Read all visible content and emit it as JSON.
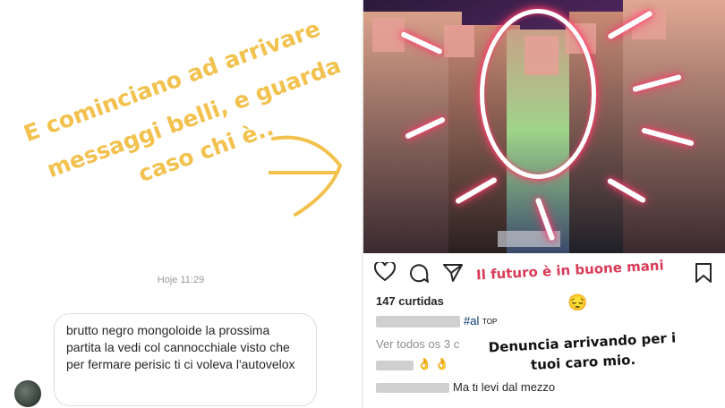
{
  "story": {
    "handwritten_lines": [
      "E cominciano ad arrivare",
      "messaggi belli, e guarda",
      "caso chi è.."
    ],
    "accent_color": "#f2c14e"
  },
  "dm": {
    "timestamp": "Hoje 11:29",
    "message": "brutto negro mongoloide la prossima partita la vedi col cannocchiale visto che per fermare perisic ti ci voleva l'autovelox"
  },
  "post": {
    "likes": "147 curtidas",
    "caption_tag": "#al",
    "top_label": "TOP",
    "view_all": "Ver todos os 3 c",
    "comment1_emojis": "👌 👌",
    "comment2_text": "Ma ti levi dal mezzo",
    "icons": [
      "heart-icon",
      "comment-icon",
      "share-icon",
      "bookmark-icon"
    ]
  },
  "stickers": {
    "futuro": "Il futuro è in buone mani",
    "futuro_emoji": "😔",
    "denuncia": "Denuncia arrivando per i tuoi caro mio."
  }
}
